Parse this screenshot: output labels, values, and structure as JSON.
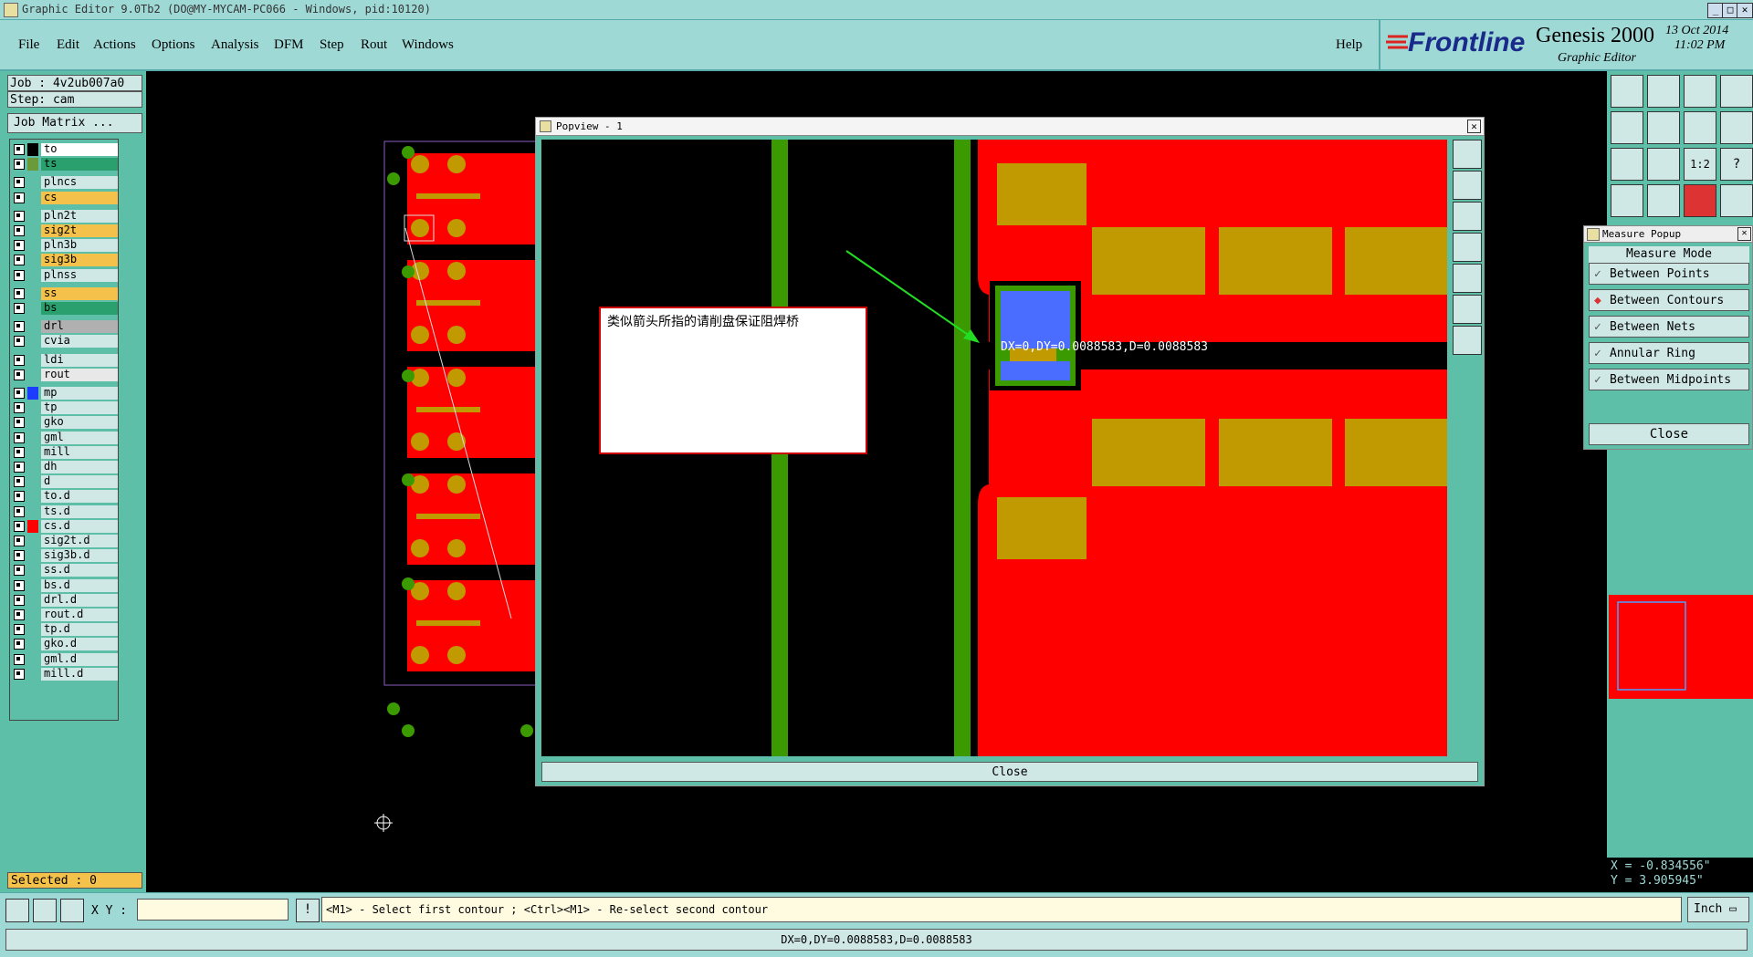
{
  "window": {
    "title": "Graphic Editor 9.0Tb2 (DO@MY-MYCAM-PC066 - Windows, pid:10120)"
  },
  "menu": {
    "items": [
      "File",
      "Edit",
      "Actions",
      "Options",
      "Analysis",
      "DFM",
      "Step",
      "Rout",
      "Windows"
    ],
    "help": "Help"
  },
  "brand": {
    "logo": "Frontline",
    "product": "Genesis 2000",
    "subtitle": "Graphic Editor",
    "date": "13 Oct 2014",
    "time": "11:02 PM"
  },
  "job": {
    "job_label": "Job : 4v2ub007a0",
    "step_label": "Step: cam",
    "matrix_button": "Job Matrix ..."
  },
  "layers": [
    {
      "name": "to",
      "bg": "#ffffff",
      "swatch": "#000000"
    },
    {
      "name": "ts",
      "bg": "#2aa06e",
      "swatch": "#6a9a3a"
    },
    {
      "name": "plncs",
      "bg": "#cfe8e6",
      "swatch": ""
    },
    {
      "name": "cs",
      "bg": "#f4c24a",
      "swatch": ""
    },
    {
      "name": "pln2t",
      "bg": "#cfe8e6",
      "swatch": ""
    },
    {
      "name": "sig2t",
      "bg": "#f4c24a",
      "swatch": ""
    },
    {
      "name": "pln3b",
      "bg": "#cfe8e6",
      "swatch": ""
    },
    {
      "name": "sig3b",
      "bg": "#f4c24a",
      "swatch": ""
    },
    {
      "name": "plnss",
      "bg": "#cfe8e6",
      "swatch": ""
    },
    {
      "name": "ss",
      "bg": "#f4c24a",
      "swatch": ""
    },
    {
      "name": "bs",
      "bg": "#2aa06e",
      "swatch": ""
    },
    {
      "name": "drl",
      "bg": "#b0b0b0",
      "swatch": ""
    },
    {
      "name": "cvia",
      "bg": "#cfe8e6",
      "swatch": ""
    },
    {
      "name": "ldi",
      "bg": "#cfe8e6",
      "swatch": ""
    },
    {
      "name": "rout",
      "bg": "#e8e8e8",
      "swatch": ""
    },
    {
      "name": "mp",
      "bg": "#cfe8e6",
      "swatch": "#1e3cff"
    },
    {
      "name": "tp",
      "bg": "#cfe8e6",
      "swatch": ""
    },
    {
      "name": "gko",
      "bg": "#cfe8e6",
      "swatch": ""
    },
    {
      "name": "gml",
      "bg": "#cfe8e6",
      "swatch": ""
    },
    {
      "name": "mill",
      "bg": "#cfe8e6",
      "swatch": ""
    },
    {
      "name": "dh",
      "bg": "#cfe8e6",
      "swatch": ""
    },
    {
      "name": "d",
      "bg": "#cfe8e6",
      "swatch": ""
    },
    {
      "name": "to.d",
      "bg": "#cfe8e6",
      "swatch": ""
    },
    {
      "name": "ts.d",
      "bg": "#cfe8e6",
      "swatch": ""
    },
    {
      "name": "cs.d",
      "bg": "#cfe8e6",
      "swatch": "#ff0000"
    },
    {
      "name": "sig2t.d",
      "bg": "#cfe8e6",
      "swatch": ""
    },
    {
      "name": "sig3b.d",
      "bg": "#cfe8e6",
      "swatch": ""
    },
    {
      "name": "ss.d",
      "bg": "#cfe8e6",
      "swatch": ""
    },
    {
      "name": "bs.d",
      "bg": "#cfe8e6",
      "swatch": ""
    },
    {
      "name": "drl.d",
      "bg": "#cfe8e6",
      "swatch": ""
    },
    {
      "name": "rout.d",
      "bg": "#cfe8e6",
      "swatch": ""
    },
    {
      "name": "tp.d",
      "bg": "#cfe8e6",
      "swatch": ""
    },
    {
      "name": "gko.d",
      "bg": "#cfe8e6",
      "swatch": ""
    },
    {
      "name": "gml.d",
      "bg": "#cfe8e6",
      "swatch": ""
    },
    {
      "name": "mill.d",
      "bg": "#cfe8e6",
      "swatch": ""
    }
  ],
  "selected": "Selected : 0",
  "popview": {
    "title": "Popview - 1",
    "annotation": "类似箭头所指的请削盘保证阻焊桥",
    "measure_text": "DX=0,DY=0.0088583,D=0.0088583",
    "close": "Close"
  },
  "measure_popup": {
    "title": "Measure Popup",
    "heading": "Measure Mode",
    "options": [
      "Between Points",
      "Between Contours",
      "Between Nets",
      "Annular Ring",
      "Between Midpoints"
    ],
    "selected_index": 1,
    "close": "Close"
  },
  "coords": {
    "x": "X = -0.834556\"",
    "y": "Y = 3.905945\""
  },
  "command": {
    "xy_label": "X Y :",
    "input_value": "",
    "prompt": "<M1> - Select first contour ; <Ctrl><M1> - Re-select second contour",
    "units": "Inch"
  },
  "status": {
    "text": "DX=0,DY=0.0088583,D=0.0088583"
  },
  "colors": {
    "copper": "#ff0000",
    "pad": "#c09a00",
    "trace": "#3a9a00",
    "selection": "#4a6cff",
    "panel": "#5dbfa8",
    "chrome": "#9fd9d6"
  }
}
